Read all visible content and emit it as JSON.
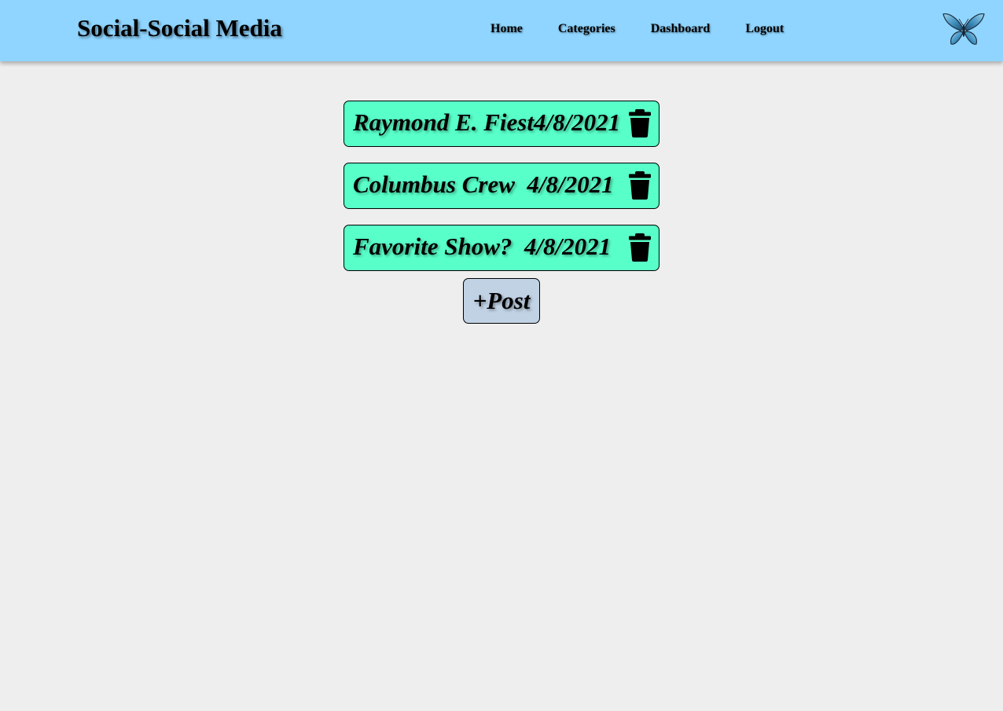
{
  "header": {
    "title": "Social-Social Media",
    "nav": [
      {
        "label": "Home"
      },
      {
        "label": "Categories"
      },
      {
        "label": "Dashboard"
      },
      {
        "label": "Logout"
      }
    ],
    "logo_icon": "butterfly-icon",
    "background_color": "#8fd5ff"
  },
  "posts": [
    {
      "title": "Raymond E. Fiest",
      "date": "4/8/2021",
      "separator": "",
      "icon": "trash-icon"
    },
    {
      "title": "Columbus Crew",
      "date": "4/8/2021",
      "separator": "  ",
      "icon": "trash-icon"
    },
    {
      "title": "Favorite Show?",
      "date": "4/8/2021",
      "separator": "  ",
      "icon": "trash-icon"
    }
  ],
  "post_color": "#58ffc8",
  "add_post": {
    "label": "+Post",
    "color": "#c0d2e4"
  },
  "page_background": "#eeeeee"
}
